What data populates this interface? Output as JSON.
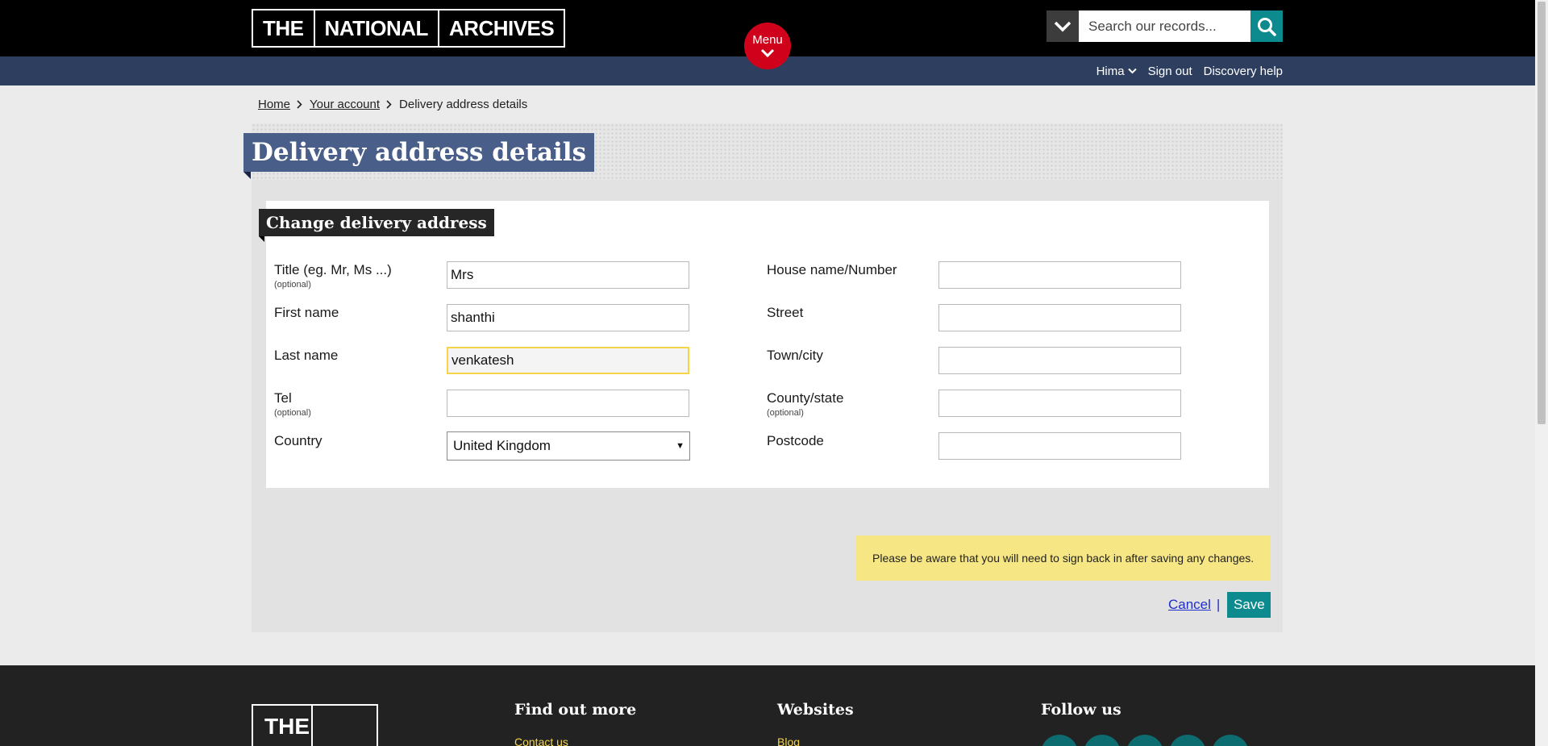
{
  "header": {
    "logo_words": [
      "THE",
      "NATIONAL",
      "ARCHIVES"
    ],
    "menu_label": "Menu",
    "search_placeholder": "Search our records...",
    "user_name": "Hima",
    "sign_out": "Sign out",
    "help": "Discovery help"
  },
  "breadcrumb": {
    "home": "Home",
    "account": "Your account",
    "current": "Delivery address details"
  },
  "page": {
    "title": "Delivery address details",
    "section_title": "Change delivery address",
    "optional_note": "(optional)",
    "left_fields": {
      "title_label": "Title (eg. Mr, Ms ...)",
      "title_value": "Mrs",
      "first_label": "First name",
      "first_value": "shanthi",
      "last_label": "Last name",
      "last_value": "venkatesh",
      "tel_label": "Tel",
      "tel_value": "",
      "country_label": "Country",
      "country_value": "United Kingdom"
    },
    "right_fields": {
      "house_label": "House name/Number",
      "street_label": "Street",
      "town_label": "Town/city",
      "county_label": "County/state",
      "postcode_label": "Postcode"
    },
    "notice": "Please be aware that you will need to sign back in after saving any changes.",
    "cancel": "Cancel",
    "separator": "|",
    "save": "Save"
  },
  "footer": {
    "logo_word": "THE",
    "find_out_more": "Find out more",
    "contact": "Contact us",
    "websites": "Websites",
    "blog": "Blog",
    "follow": "Follow us"
  },
  "colors": {
    "header_bg": "#000000",
    "subnav_bg": "#2d3e5f",
    "menu_red": "#d0021b",
    "teal": "#0d8a8e",
    "title_blue": "#4a5e8a",
    "notice_yellow": "#f6e784"
  }
}
